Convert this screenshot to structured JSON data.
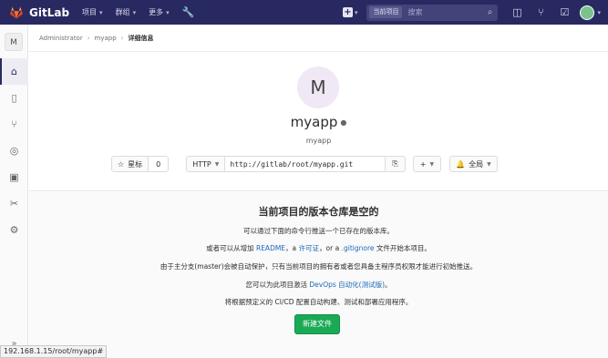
{
  "brand": {
    "name": "GitLab",
    "logo_icon": "gitlab-tanuki-icon"
  },
  "nav": {
    "menu": [
      {
        "label": "项目",
        "has_dropdown": true
      },
      {
        "label": "群组",
        "has_dropdown": true
      },
      {
        "label": "更多",
        "has_dropdown": true
      }
    ],
    "search": {
      "scope_label": "当前项目",
      "placeholder": "搜索"
    }
  },
  "sidebar": {
    "avatar_letter": "M",
    "items": [
      {
        "icon": "home-icon",
        "active": true
      },
      {
        "icon": "repository-icon",
        "active": false
      },
      {
        "icon": "merge-request-icon",
        "active": false
      },
      {
        "icon": "issues-icon",
        "active": false
      },
      {
        "icon": "wiki-icon",
        "active": false
      },
      {
        "icon": "snippets-icon",
        "active": false
      },
      {
        "icon": "settings-gear-icon",
        "active": false
      }
    ]
  },
  "breadcrumb": {
    "admin": "Administrator",
    "project": "myapp",
    "current": "详细信息"
  },
  "project": {
    "avatar_letter": "M",
    "name": "myapp",
    "path": "myapp",
    "star_label": "星标",
    "star_count": "0",
    "clone_protocol": "HTTP",
    "clone_url": "http://gitlab/root/myapp.git",
    "notification_label": "全局"
  },
  "empty_repo": {
    "title": "当前项目的版本仓库是空的",
    "line1": "可以通过下面的命令行推送一个已存在的版本库。",
    "line2_pre": "或者可以从增加",
    "line2_readme": "README",
    "line2_mid": "，a",
    "line2_license": "许可证",
    "line2_or": "，or a",
    "line2_gitignore": ".gitignore",
    "line2_post": "文件开始本项目。",
    "line3": "由于主分支(master)会被自动保护，只有当前项目的拥有者或者您具备主程序员权限才能进行初始推送。",
    "line4_pre": "您可以为此项目激活",
    "line4_link": "DevOps 自动化(测试版)",
    "line4_post": "。",
    "line5": "将根据预定义的 CI/CD 配置自动构建、测试和部署应用程序。",
    "new_file_label": "新建文件"
  },
  "statusbar": {
    "url": "192.168.1.15/root/myapp#"
  },
  "colors": {
    "navbar": "#292961",
    "accent_green": "#1aaa55",
    "link": "#1b69b6"
  }
}
